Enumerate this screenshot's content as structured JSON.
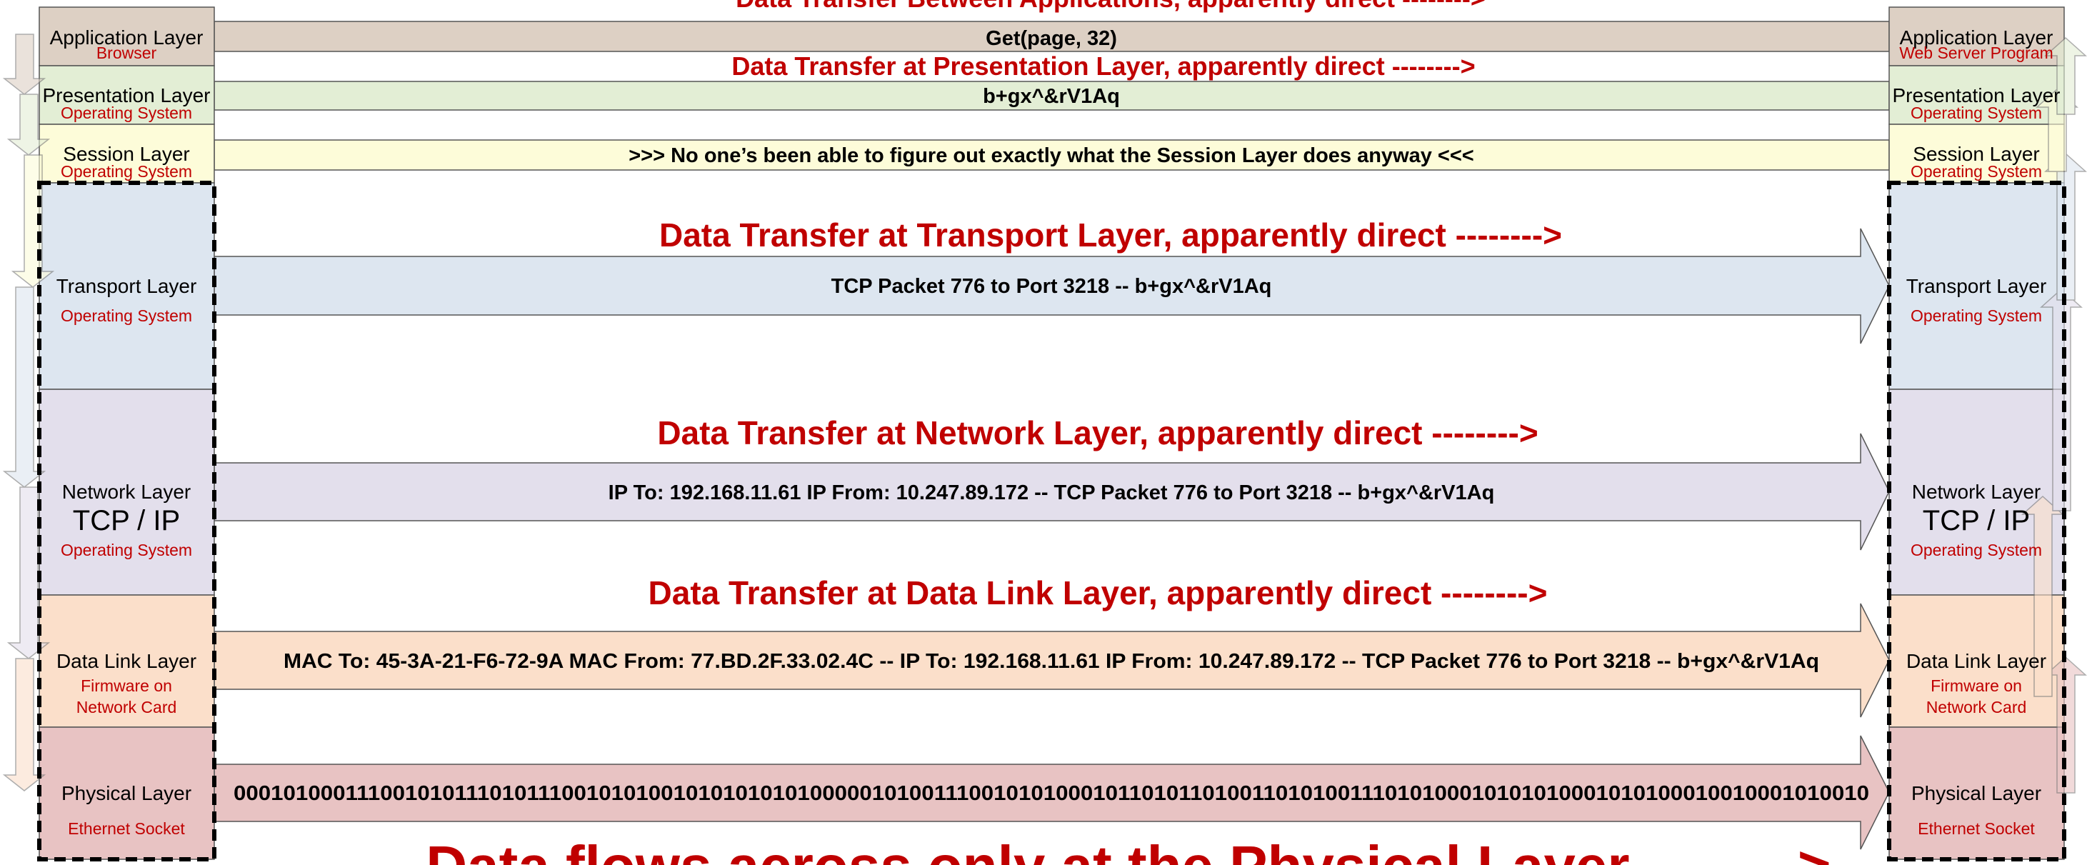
{
  "colors": {
    "application": "#ddd0c4",
    "presentation": "#e3eed5",
    "session": "#fdfcd9",
    "transport": "#dde6f0",
    "network": "#e3dfec",
    "datalink": "#fbdfca",
    "physical": "#e8c3c3",
    "heading": "#c00000",
    "dashed_border": "#000000"
  },
  "left_stack": {
    "application": {
      "name": "Application Layer",
      "sub": "Browser"
    },
    "presentation": {
      "name": "Presentation Layer",
      "sub": "Operating System"
    },
    "session": {
      "name": "Session Layer",
      "sub": "Operating System"
    },
    "transport": {
      "name": "Transport Layer",
      "sub": "Operating System"
    },
    "network": {
      "name": "Network Layer",
      "big": "TCP / IP",
      "sub": "Operating System"
    },
    "datalink": {
      "name": "Data Link Layer",
      "sub1": "Firmware on",
      "sub2": "Network Card"
    },
    "physical": {
      "name": "Physical Layer",
      "sub": "Ethernet Socket"
    }
  },
  "right_stack": {
    "application": {
      "name": "Application Layer",
      "sub": "Web  Server Program"
    },
    "presentation": {
      "name": "Presentation Layer",
      "sub": "Operating System"
    },
    "session": {
      "name": "Session Layer",
      "sub": "Operating System"
    },
    "transport": {
      "name": "Transport Layer",
      "sub": "Operating System"
    },
    "network": {
      "name": "Network Layer",
      "big": "TCP / IP",
      "sub": "Operating System"
    },
    "datalink": {
      "name": "Data Link Layer",
      "sub1": "Firmware on",
      "sub2": "Network Card"
    },
    "physical": {
      "name": "Physical Layer",
      "sub": "Ethernet Socket"
    }
  },
  "headings": {
    "application": "Data Transfer Between Applications, apparently direct -------->",
    "presentation": "Data Transfer at Presentation Layer, apparently direct -------->",
    "transport": "Data Transfer at Transport Layer, apparently direct -------->",
    "network": "Data Transfer at Network Layer, apparently direct -------->",
    "datalink": "Data Transfer at Data Link Layer, apparently direct -------->",
    "physical": "Data flows across only at the Physical Layer -------->"
  },
  "payloads": {
    "application": "Get(page, 32)",
    "presentation": "b+gx^&rV1Aq",
    "session": ">>> No one’s been able to figure out exactly what the Session Layer does anyway <<<",
    "transport": "TCP Packet 776 to Port 3218 -- b+gx^&rV1Aq",
    "network": "IP To: 192.168.11.61 IP From: 10.247.89.172 -- TCP Packet 776 to Port 3218 -- b+gx^&rV1Aq",
    "datalink": "MAC To: 45-3A-21-F6-72-9A MAC From: 77.BD.2F.33.02.4C -- IP To: 192.168.11.61 IP From: 10.247.89.172 -- TCP Packet 776 to Port 3218 -- b+gx^&rV1Aq",
    "physical": "0001010001110010101110101110010101001010101010100000101001110010101000101101011010011010100111010100010101010001010100010010001010010"
  }
}
